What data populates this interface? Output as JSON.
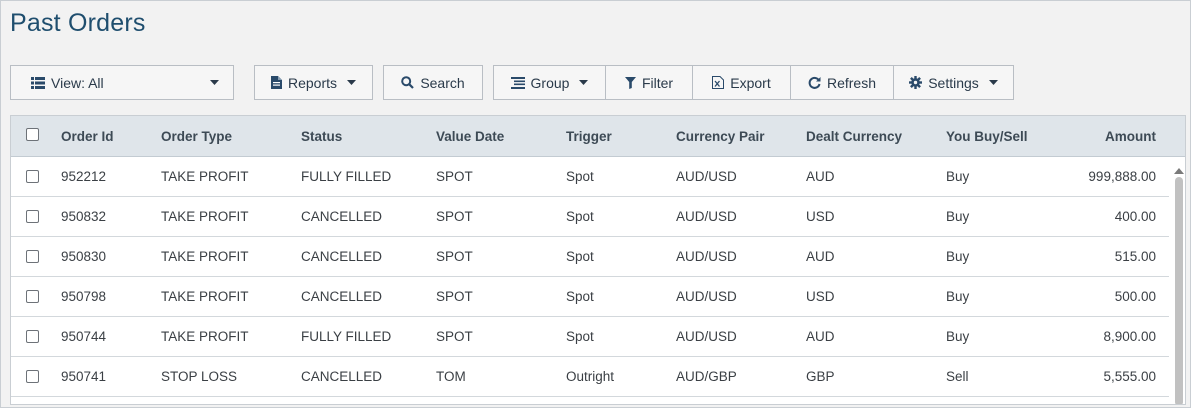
{
  "page": {
    "title": "Past Orders"
  },
  "toolbar": {
    "view_label": "View: All",
    "reports_label": "Reports",
    "search_label": "Search",
    "group_label": "Group",
    "filter_label": "Filter",
    "export_label": "Export",
    "refresh_label": "Refresh",
    "settings_label": "Settings"
  },
  "icons": {
    "view": "list-icon",
    "reports": "document-icon",
    "search": "search-icon",
    "group": "group-list-icon",
    "filter": "filter-icon",
    "export": "excel-icon",
    "refresh": "refresh-icon",
    "settings": "gear-icon",
    "caret": "caret-down-icon"
  },
  "table": {
    "columns": [
      "Order Id",
      "Order Type",
      "Status",
      "Value Date",
      "Trigger",
      "Currency Pair",
      "Dealt Currency",
      "You Buy/Sell",
      "Amount"
    ],
    "rows": [
      [
        "952212",
        "TAKE PROFIT",
        "FULLY FILLED",
        "SPOT",
        "Spot",
        "AUD/USD",
        "AUD",
        "Buy",
        "999,888.00"
      ],
      [
        "950832",
        "TAKE PROFIT",
        "CANCELLED",
        "SPOT",
        "Spot",
        "AUD/USD",
        "USD",
        "Buy",
        "400.00"
      ],
      [
        "950830",
        "TAKE PROFIT",
        "CANCELLED",
        "SPOT",
        "Spot",
        "AUD/USD",
        "AUD",
        "Buy",
        "515.00"
      ],
      [
        "950798",
        "TAKE PROFIT",
        "CANCELLED",
        "SPOT",
        "Spot",
        "AUD/USD",
        "USD",
        "Buy",
        "500.00"
      ],
      [
        "950744",
        "TAKE PROFIT",
        "FULLY FILLED",
        "SPOT",
        "Spot",
        "AUD/USD",
        "AUD",
        "Buy",
        "8,900.00"
      ],
      [
        "950741",
        "STOP LOSS",
        "CANCELLED",
        "TOM",
        "Outright",
        "AUD/GBP",
        "GBP",
        "Sell",
        "5,555.00"
      ]
    ]
  },
  "colors": {
    "title": "#1f4e6e",
    "header_bg": "#dfe5ea",
    "button_bg": "#f6f6f6",
    "page_bg": "#f2f2f2"
  }
}
